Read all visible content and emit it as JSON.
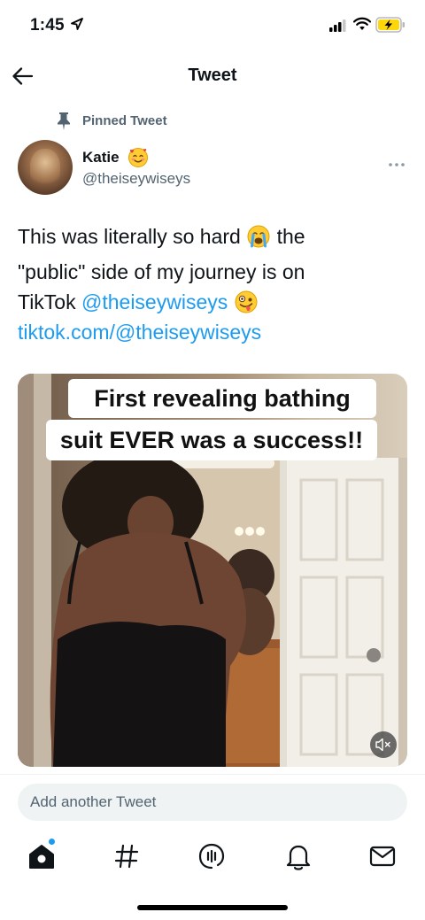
{
  "status_bar": {
    "time": "1:45"
  },
  "header": {
    "title": "Tweet"
  },
  "tweet": {
    "pinned_label": "Pinned Tweet",
    "author": {
      "name": "Katie",
      "handle": "@theiseywiseys"
    },
    "text_parts": {
      "line1_a": "This was literally so hard",
      "line1_b": " the",
      "line2": "\"public\" side of my journey is on",
      "line3_a": "TikTok ",
      "line3_mention": "@theiseywiseys",
      "line3_b": " "
    },
    "link": "tiktok.com/@theiseywiseys",
    "media_caption": {
      "line1": "First revealing bathing",
      "line2": "suit EVER was a success!!"
    }
  },
  "reply": {
    "placeholder": "Add another Tweet"
  },
  "colors": {
    "accent": "#1d9bf0",
    "secondary_text": "#536471",
    "input_bg": "#eff3f4"
  },
  "icons": [
    "back-arrow-icon",
    "pin-icon",
    "more-icon",
    "mute-icon",
    "home-icon",
    "explore-hashtag-icon",
    "spaces-icon",
    "notifications-bell-icon",
    "messages-envelope-icon"
  ]
}
